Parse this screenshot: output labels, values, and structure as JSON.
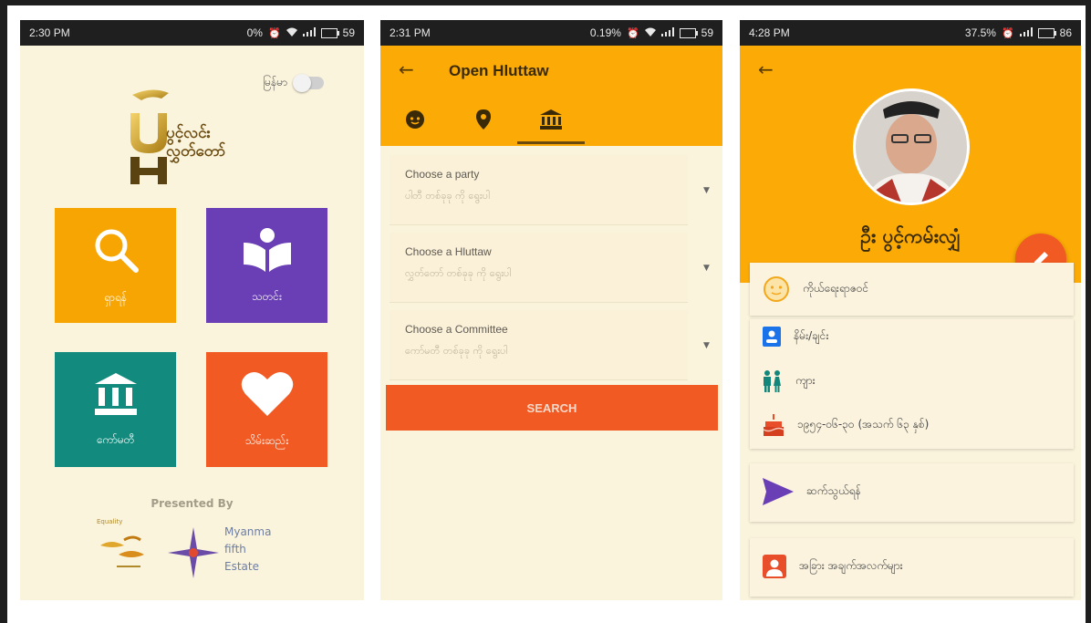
{
  "screens": [
    {
      "status": {
        "time": "2:30 PM",
        "right": "0%",
        "battery": "59"
      },
      "language_toggle_label": "မြန်မာ",
      "logo_text": "ပွင့်လင်း\nလွှတ်တော်",
      "tiles": [
        {
          "label": "ရှာရန်",
          "icon": "search-icon",
          "color": "#f7a503"
        },
        {
          "label": "သတင်း",
          "icon": "reading-book-icon",
          "color": "#6a3fb5"
        },
        {
          "label": "ကော်မတီ",
          "icon": "parliament-building-icon",
          "color": "#128b7e"
        },
        {
          "label": "သိမ်းဆည်း",
          "icon": "heart-icon",
          "color": "#f15a22"
        }
      ],
      "presented_by": "Presented By",
      "sponsors": {
        "first_label": "Equality",
        "second": [
          "Myanma",
          "fifth",
          "Estate"
        ]
      }
    },
    {
      "status": {
        "time": "2:31 PM",
        "right": "0.19%",
        "battery": "59"
      },
      "title": "Open Hluttaw",
      "tabs": [
        {
          "icon": "face-icon"
        },
        {
          "icon": "location-pin-icon"
        },
        {
          "icon": "bank-icon",
          "selected": true
        }
      ],
      "dropdowns": [
        {
          "label": "Choose a party",
          "value": "ပါတီ တစ်ခုခု ကို ရွေးပါ"
        },
        {
          "label": "Choose a Hluttaw",
          "value": "လွှတ်တော် တစ်ခုခု ကို ရွေးပါ"
        },
        {
          "label": "Choose a Committee",
          "value": "ကော်မတီ တစ်ခုခု ကို ရွေးပါ"
        }
      ],
      "search_label": "SEARCH"
    },
    {
      "status": {
        "time": "4:28 PM",
        "right": "37.5%",
        "battery": "86"
      },
      "name": "ဦး ပွင့်ကမ်းလျှံ",
      "personal_header": "ကိုယ်ရေးရာဇဝင်",
      "details": [
        {
          "icon": "id-card-icon",
          "text": "နိမ်း/ချင်း"
        },
        {
          "icon": "people-icon",
          "text": "ကျား"
        },
        {
          "icon": "cake-icon",
          "text": "၁၉၅၄-၀၆-၃၀ (အသက် ၆၃ နှစ်)"
        }
      ],
      "contact_label": "ဆက်သွယ်ရန်",
      "more_label": "အခြား အချက်အလက်များ",
      "colors": {
        "primary": "#fbaa06",
        "accent": "#f15a22",
        "send": "#6a3fb5",
        "info": "#1a73e8"
      }
    }
  ]
}
